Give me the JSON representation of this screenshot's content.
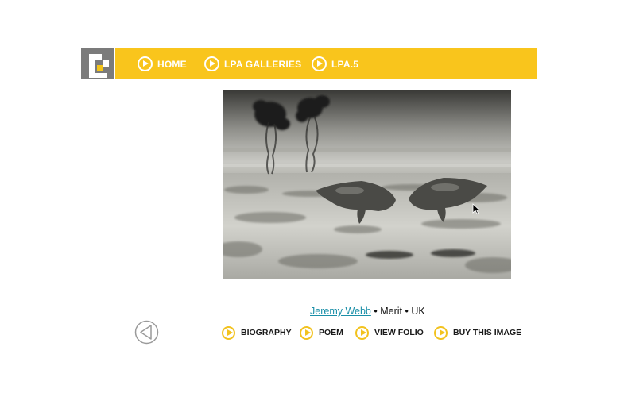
{
  "nav": {
    "items": [
      {
        "label": "HOME",
        "icon": "play-circle-icon"
      },
      {
        "label": "LPA GALLERIES",
        "icon": "play-circle-icon"
      },
      {
        "label": "LPA.5",
        "icon": "play-circle-icon"
      }
    ]
  },
  "caption": {
    "photographer": "Jeremy Webb",
    "separator1": " • ",
    "award": "Merit",
    "separator2": " • ",
    "country": "UK"
  },
  "links": [
    {
      "label": "BIOGRAPHY"
    },
    {
      "label": "POEM"
    },
    {
      "label": "VIEW FOLIO"
    },
    {
      "label": "BUY THIS IMAGE"
    }
  ],
  "colors": {
    "navbar": "#f9c51c",
    "accent_yellow": "#f2c21e",
    "logo_gray": "#7b7b7b",
    "link_teal": "#1a8fa8"
  }
}
